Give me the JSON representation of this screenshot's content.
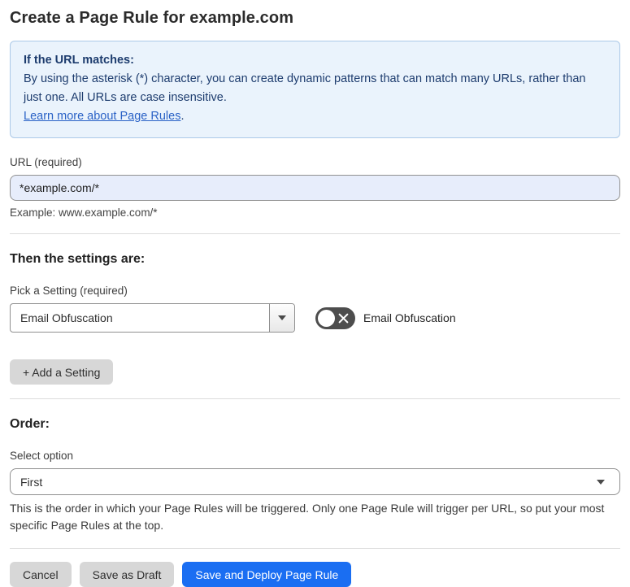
{
  "page": {
    "title": "Create a Page Rule for example.com"
  },
  "info_box": {
    "heading": "If the URL matches:",
    "body": "By using the asterisk (*) character, you can create dynamic patterns that can match many URLs, rather than just one. All URLs are case insensitive.",
    "link": "Learn more about Page Rules",
    "link_suffix": "."
  },
  "url_field": {
    "label": "URL (required)",
    "value": "*example.com/*",
    "example": "Example: www.example.com/*"
  },
  "settings_section": {
    "heading": "Then the settings are:",
    "picker_label": "Pick a Setting (required)",
    "picker_value": "Email Obfuscation",
    "toggle_state": "off",
    "toggle_label": "Email Obfuscation",
    "add_button_label": "+ Add a Setting"
  },
  "order_section": {
    "heading": "Order:",
    "label": "Select option",
    "value": "First",
    "help": "This is the order in which your Page Rules will be triggered. Only one Page Rule will trigger per URL, so put your most specific Page Rules at the top."
  },
  "footer": {
    "cancel_label": "Cancel",
    "save_draft_label": "Save as Draft",
    "save_deploy_label": "Save and Deploy Page Rule"
  },
  "colors": {
    "primary_blue": "#1a6ef2",
    "info_background": "#eaf3fc",
    "info_border": "#abc9e8",
    "info_text": "#1d3c6e",
    "link_blue": "#2a62c6",
    "input_autofill_background": "#e7edfb",
    "toggle_off_background": "#4d4d4d",
    "gray_button_background": "#d7d7d7"
  }
}
